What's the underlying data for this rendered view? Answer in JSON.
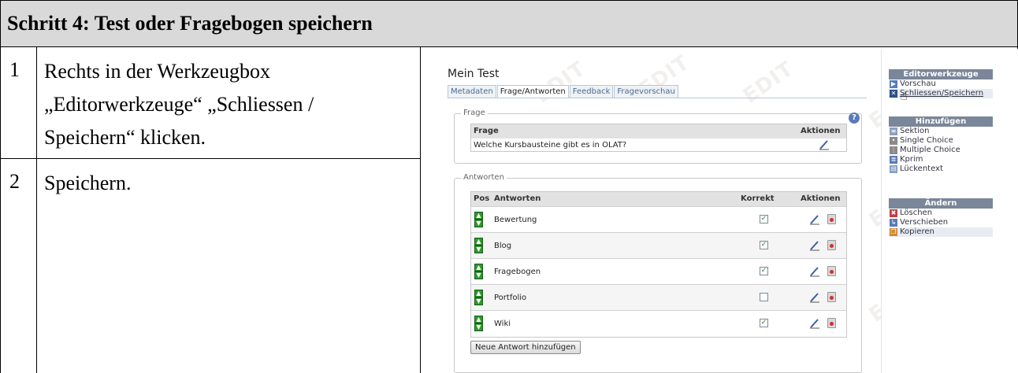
{
  "header": {
    "title": "Schritt 4: Test oder Fragebogen speichern"
  },
  "steps": [
    {
      "number": "1",
      "lines": [
        "Rechts in der Werkzeugbox",
        "„Editorwerkzeuge“ „Schliessen /",
        "Speichern“ klicken."
      ]
    },
    {
      "number": "2",
      "lines": [
        "Speichern."
      ]
    }
  ],
  "screenshot": {
    "title": "Mein Test",
    "tabs": [
      "Metadaten",
      "Frage/Antworten",
      "Feedback",
      "Fragevorschau"
    ],
    "active_tab": "Frage/Antworten",
    "watermark": "EDIT",
    "frage": {
      "legend": "Frage",
      "col_question": "Frage",
      "col_actions": "Aktionen",
      "question": "Welche Kursbausteine gibt es in OLAT?"
    },
    "antworten": {
      "legend": "Antworten",
      "col_pos": "Pos",
      "col_answers": "Antworten",
      "col_correct": "Korrekt",
      "col_actions": "Aktionen",
      "rows": [
        {
          "label": "Bewertung",
          "correct": true
        },
        {
          "label": "Blog",
          "correct": true
        },
        {
          "label": "Fragebogen",
          "correct": true
        },
        {
          "label": "Portfolio",
          "correct": false
        },
        {
          "label": "Wiki",
          "correct": true
        }
      ],
      "add_button": "Neue Antwort hinzufügen"
    },
    "sidebar": {
      "editor": {
        "title": "Editorwerkzeuge",
        "items": [
          "Vorschau",
          "Schliessen/Speichern"
        ]
      },
      "add": {
        "title": "Hinzufügen",
        "items": [
          "Sektion",
          "Single Choice",
          "Multiple Choice",
          "Kprim",
          "Lückentext"
        ]
      },
      "change": {
        "title": "Ändern",
        "items": [
          "Löschen",
          "Verschieben",
          "Kopieren"
        ]
      }
    }
  }
}
